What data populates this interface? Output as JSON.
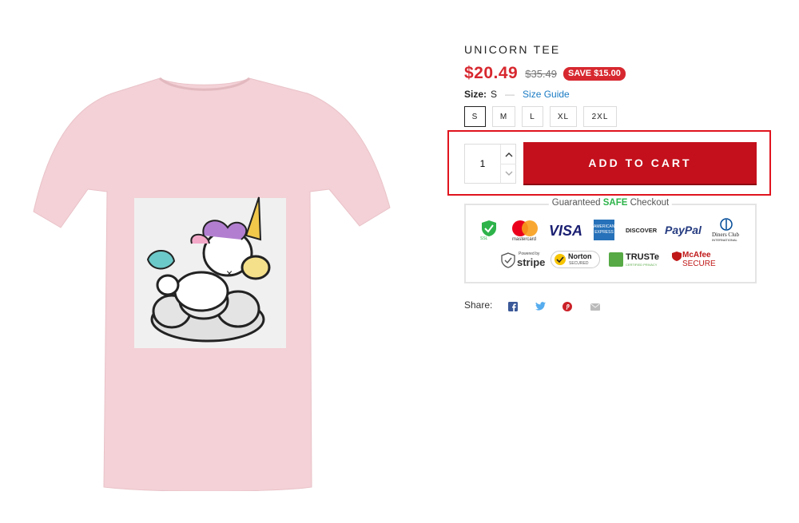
{
  "product": {
    "title": "UNICORN TEE",
    "price": "$20.49",
    "compare_price": "$35.49",
    "save_badge": "SAVE $15.00",
    "colors": {
      "price": "#d7282f",
      "button": "#c4101c",
      "shirt": "#f3d1d6",
      "highlight": "#e0141e",
      "link": "#1a7bc4",
      "safe": "#2db34a"
    }
  },
  "size": {
    "label": "Size:",
    "selected": "S",
    "dash": "—",
    "guide_link": "Size Guide",
    "options": [
      "S",
      "M",
      "L",
      "XL",
      "2XL"
    ]
  },
  "cart": {
    "quantity": "1",
    "add_button": "ADD TO CART"
  },
  "checkout": {
    "title_prefix": "Guaranteed ",
    "title_safe": "SAFE",
    "title_suffix": " Checkout",
    "ssl_text": "SSL",
    "mastercard_text": "mastercard",
    "visa_text": "VISA",
    "amex_text": "AMERICAN EXPRESS",
    "discover_text": "DISCOVER",
    "paypal_text": "PayPal",
    "diners_line1": "Diners Club",
    "diners_line2": "INTERNATIONAL",
    "stripe_small": "Powered by",
    "stripe_text": "stripe",
    "norton_text": "Norton",
    "norton_sub": "SECURED",
    "truste_text": "TRUSTe",
    "truste_sub": "CERTIFIED PRIVACY",
    "mcafee_text": "McAfee",
    "mcafee_sub": "SECURE"
  },
  "share": {
    "label": "Share:",
    "icons": [
      "facebook-icon",
      "twitter-icon",
      "pinterest-icon",
      "email-icon"
    ]
  }
}
